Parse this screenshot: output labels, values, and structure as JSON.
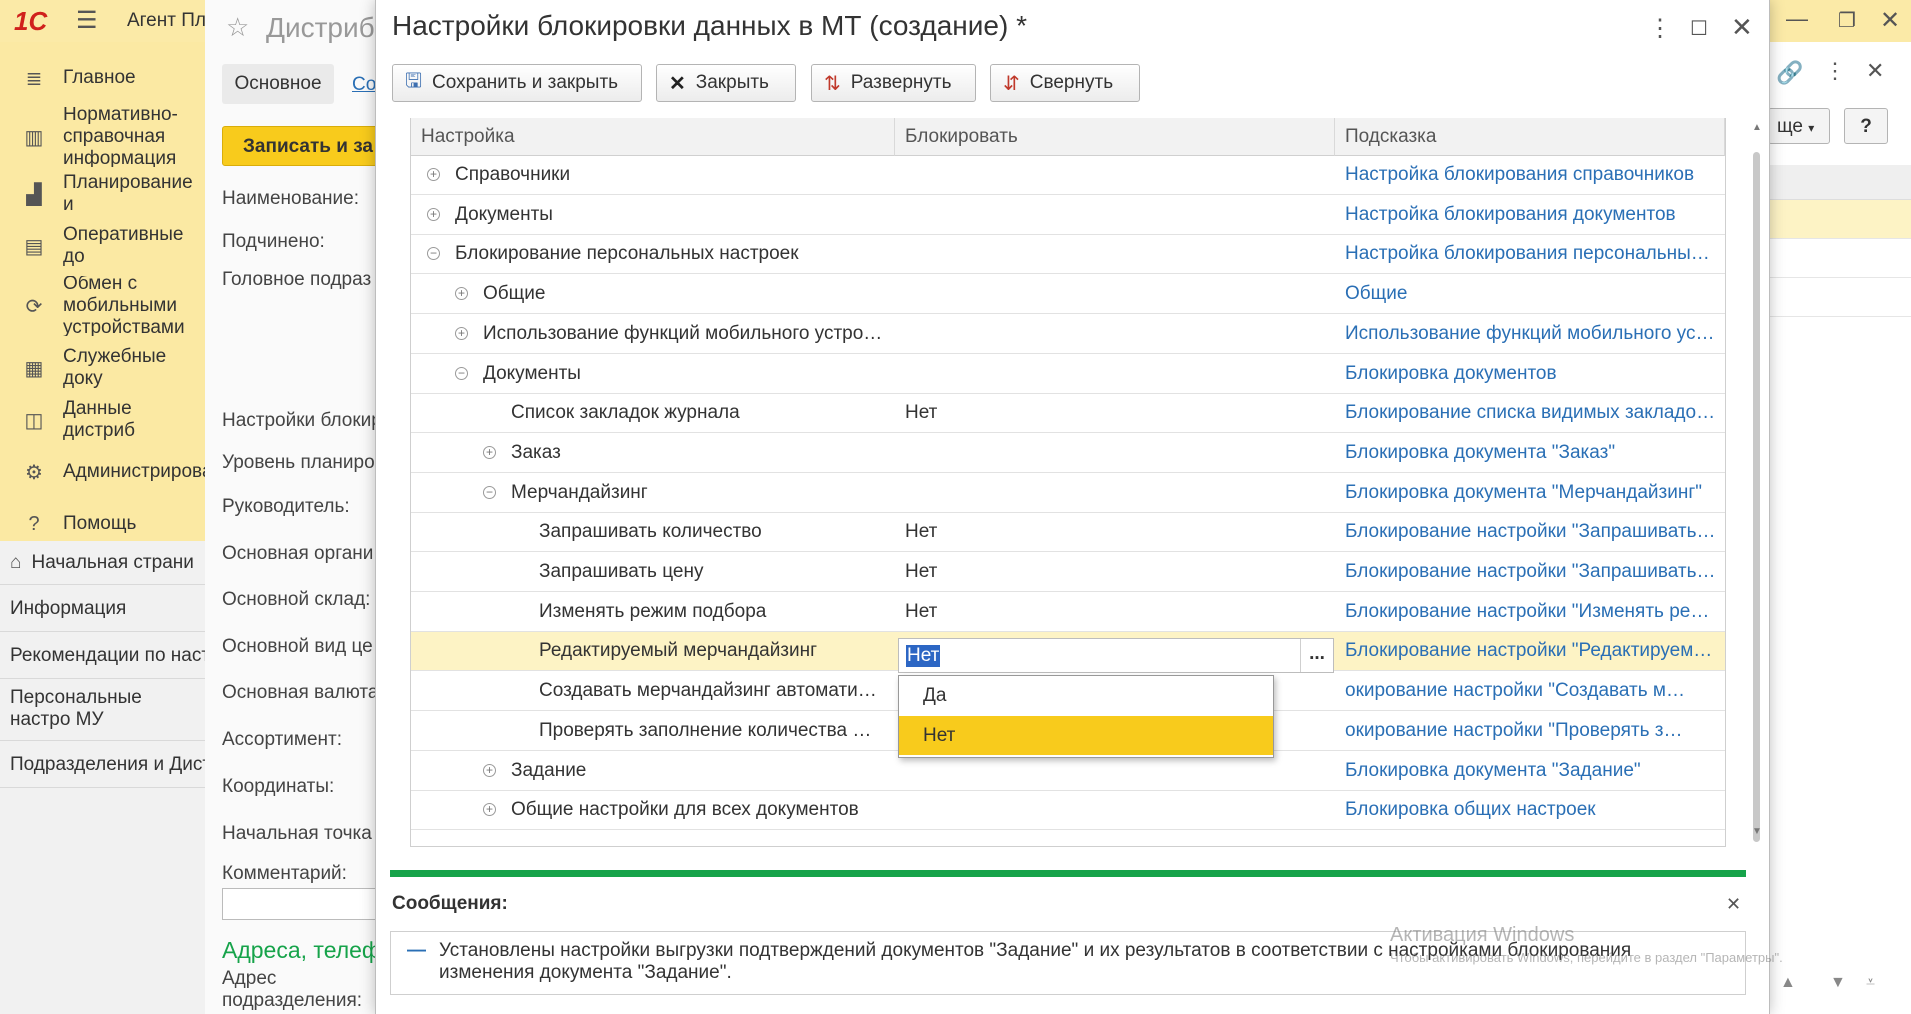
{
  "app": {
    "name": "Агент Пл"
  },
  "sidebar": [
    {
      "label": "Главное",
      "icon": "menu-lines-icon"
    },
    {
      "label": "Нормативно-справочная информация",
      "icon": "bar-chart-icon"
    },
    {
      "label": "Планирование и",
      "icon": "planning-chart-icon"
    },
    {
      "label": "Оперативные до",
      "icon": "documents-icon"
    },
    {
      "label": "Обмен с мобильными устройствами",
      "icon": "exchange-icon"
    },
    {
      "label": "Служебные доку",
      "icon": "service-docs-icon"
    },
    {
      "label": "Данные дистриб",
      "icon": "distributor-data-icon"
    },
    {
      "label": "Администрирова",
      "icon": "gear-icon"
    },
    {
      "label": "Помощь",
      "icon": "help-icon"
    }
  ],
  "nav": [
    "Начальная страни",
    "Информация",
    "Рекомендации по наст",
    "Персональные настро МУ",
    "Подразделения и Дист"
  ],
  "bgform": {
    "title": "Дистриб",
    "tab_main": "Основное",
    "tab_other": "Со",
    "save_button": "Записать и за",
    "labels": [
      "Наименование:",
      "Подчинено:",
      "Головное подраз",
      "Настройки блокир",
      "Уровень планиро",
      "Руководитель:",
      "Основная органи",
      "Основной склад:",
      "Основной вид це",
      "Основная валюта",
      "Ассортимент:",
      "Координаты:",
      "Начальная точка",
      "Комментарий:"
    ],
    "section": "Адреса, телеф",
    "address_label": "Адрес подразделения:"
  },
  "rightstrip": {
    "more_button": "ще",
    "help_button": "?"
  },
  "dialog": {
    "title": "Настройки блокировки данных в МТ (создание) *",
    "toolbar": {
      "save_close": "Сохранить и закрыть",
      "close": "Закрыть",
      "expand": "Развернуть",
      "collapse": "Свернуть"
    },
    "columns": [
      "Настройка",
      "Блокировать",
      "Подсказка"
    ],
    "rows": [
      {
        "level": 0,
        "toggle": "plus",
        "name": "Справочники",
        "value": "",
        "hint": "Настройка блокирования справочников"
      },
      {
        "level": 0,
        "toggle": "plus",
        "name": "Документы",
        "value": "",
        "hint": "Настройка блокирования документов"
      },
      {
        "level": 0,
        "toggle": "minus",
        "name": "Блокирование персональных настроек",
        "value": "",
        "hint": "Настройка блокирования персональных…"
      },
      {
        "level": 1,
        "toggle": "plus",
        "name": "Общие",
        "value": "",
        "hint": "Общие"
      },
      {
        "level": 1,
        "toggle": "plus",
        "name": "Использование функций мобильного устро…",
        "value": "",
        "hint": "Использование функций мобильного ус…"
      },
      {
        "level": 1,
        "toggle": "minus",
        "name": "Документы",
        "value": "",
        "hint": "Блокировка документов"
      },
      {
        "level": 2,
        "toggle": "",
        "name": "Список закладок журнала",
        "value": "Нет",
        "hint": "Блокирование списка видимых закладо…"
      },
      {
        "level": 2,
        "toggle": "plus",
        "name": "Заказ",
        "value": "",
        "hint": "Блокировка документа \"Заказ\""
      },
      {
        "level": 2,
        "toggle": "minus",
        "name": "Мерчандайзинг",
        "value": "",
        "hint": "Блокировка документа \"Мерчандайзинг\""
      },
      {
        "level": 3,
        "toggle": "",
        "name": "Запрашивать количество",
        "value": "Нет",
        "hint": "Блокирование настройки \"Запрашивать…"
      },
      {
        "level": 3,
        "toggle": "",
        "name": "Запрашивать цену",
        "value": "Нет",
        "hint": "Блокирование настройки \"Запрашивать…"
      },
      {
        "level": 3,
        "toggle": "",
        "name": "Изменять режим подбора",
        "value": "Нет",
        "hint": "Блокирование настройки \"Изменять ре…"
      },
      {
        "level": 3,
        "toggle": "",
        "name": "Редактируемый мерчандайзинг",
        "value": "Нет",
        "hint": "Блокирование настройки \"Редактируем…",
        "selected": true
      },
      {
        "level": 3,
        "toggle": "",
        "name": "Создавать мерчандайзинг автомати…",
        "value": "",
        "hint": "окирование настройки \"Создавать м…"
      },
      {
        "level": 3,
        "toggle": "",
        "name": "Проверять заполнение количества ф…",
        "value": "",
        "hint": "окирование настройки \"Проверять з…"
      },
      {
        "level": 2,
        "toggle": "plus",
        "name": "Задание",
        "value": "",
        "hint": "Блокировка документа \"Задание\""
      },
      {
        "level": 2,
        "toggle": "plus",
        "name": "Общие настройки для всех документов",
        "value": "",
        "hint": "Блокировка общих настроек"
      }
    ],
    "edit_choice_button": "...",
    "dropdown_options": [
      "Да",
      "Нет"
    ],
    "dropdown_selected": "Нет",
    "messages_title": "Сообщения:",
    "message_text": "Установлены настройки выгрузки подтверждений документов \"Задание\" и их результатов в соответствии с настройками блокирования изменения документа \"Задание\".",
    "message_marker": "—",
    "watermark_title": "Активация Windows",
    "watermark_sub": "Чтобы активировать Windows, перейдите в раздел \"Параметры\"."
  },
  "colors": {
    "accent": "#f8cb1c",
    "sidebar_bg": "#fbe9a3",
    "link": "#2a6fb5",
    "selected_row": "#fdf3c5",
    "message_bar": "#16a34a"
  }
}
